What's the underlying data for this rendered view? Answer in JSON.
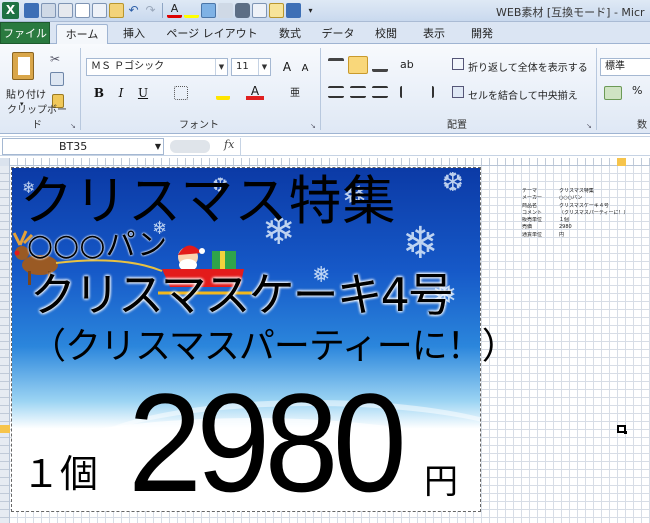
{
  "window": {
    "title": "WEB素材 [互換モード] - Micr"
  },
  "tabs": [
    {
      "label": "ファイル"
    },
    {
      "label": "ホーム"
    },
    {
      "label": "挿入"
    },
    {
      "label": "ページ レイアウト"
    },
    {
      "label": "数式"
    },
    {
      "label": "データ"
    },
    {
      "label": "校閲"
    },
    {
      "label": "表示"
    },
    {
      "label": "開発"
    }
  ],
  "ribbon": {
    "clipboard": {
      "paste_label": "貼り付け",
      "group_label": "クリップボード"
    },
    "font": {
      "font_name": "ＭＳ Ｐゴシック",
      "font_size": "11",
      "group_label": "フォント",
      "bold": "B",
      "italic": "I",
      "underline": "U",
      "grow": "A",
      "shrink": "A",
      "font_color": "A"
    },
    "alignment": {
      "wrap_label": "折り返して全体を表示する",
      "merge_label": "セルを結合して中央揃え",
      "group_label": "配置"
    },
    "number": {
      "format": "標準",
      "group_label": "数"
    }
  },
  "formula_bar": {
    "name_box": "BT35",
    "fx": "fx",
    "formula": ""
  },
  "poster": {
    "title": "クリスマス特集",
    "maker": "○○○パン",
    "product": "クリスマスケーキ4号",
    "comment": "（クリスマスパーティーに！）",
    "unit": "１個",
    "price": "2980",
    "yen": "円"
  },
  "data_table": [
    {
      "key": "テーマ",
      "value": "クリスマス特集"
    },
    {
      "key": "メーカー",
      "value": "○○○パン"
    },
    {
      "key": "商品名",
      "value": "クリスマスケーキ４号"
    },
    {
      "key": "コメント",
      "value": "（クリスマスパーティーに！）"
    },
    {
      "key": "販売単位",
      "value": "１個"
    },
    {
      "key": "売価",
      "value": "2980"
    },
    {
      "key": "通貨単位",
      "value": "円"
    }
  ],
  "colors": {
    "file_tab": "#2a7a3f",
    "ribbon_bg": "#dfe8f5",
    "poster_sky": "#1659c8",
    "selection": "#f6c44b"
  }
}
